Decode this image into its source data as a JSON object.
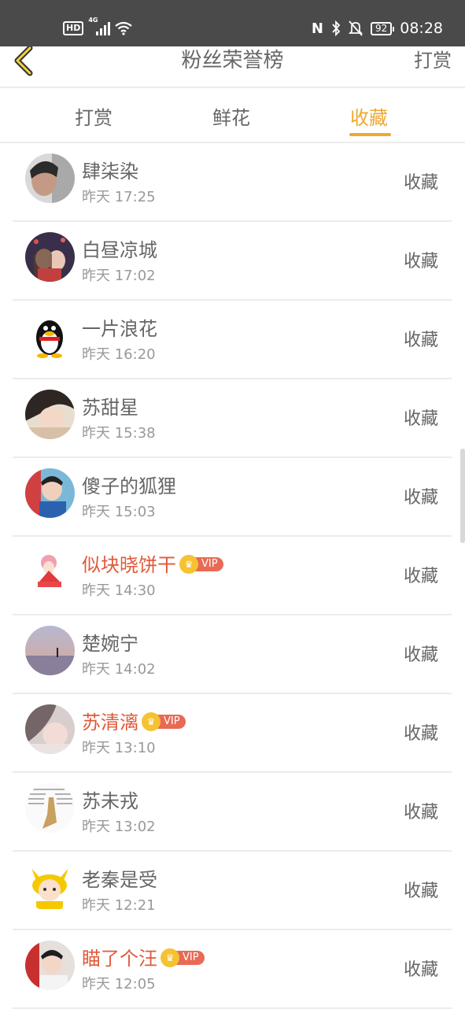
{
  "status_bar": {
    "hd": "HD",
    "network": "4G",
    "battery": "92",
    "time": "08:28"
  },
  "header": {
    "title": "粉丝荣誉榜",
    "action": "打赏"
  },
  "tabs": [
    {
      "label": "打赏",
      "active": false
    },
    {
      "label": "鲜花",
      "active": false
    },
    {
      "label": "收藏",
      "active": true
    }
  ],
  "colors": {
    "accent": "#f0a830",
    "vip_name": "#e05a3a",
    "vip_tag": "#e86a55",
    "crown": "#f5c232"
  },
  "vip_label": "VIP",
  "rows": [
    {
      "name": "肆柒染",
      "time": "昨天 17:25",
      "action": "收藏",
      "vip": false,
      "avatar": "photo-avatar"
    },
    {
      "name": "白昼凉城",
      "time": "昨天 17:02",
      "action": "收藏",
      "vip": false,
      "avatar": "anime-avatar"
    },
    {
      "name": "一片浪花",
      "time": "昨天 16:20",
      "action": "收藏",
      "vip": false,
      "avatar": "penguin-avatar"
    },
    {
      "name": "苏甜星",
      "time": "昨天 15:38",
      "action": "收藏",
      "vip": false,
      "avatar": "photo-avatar"
    },
    {
      "name": "傻子的狐狸",
      "time": "昨天 15:03",
      "action": "收藏",
      "vip": false,
      "avatar": "photo-avatar"
    },
    {
      "name": "似块晓饼干",
      "time": "昨天 14:30",
      "action": "收藏",
      "vip": true,
      "avatar": "anime-avatar"
    },
    {
      "name": "楚婉宁",
      "time": "昨天 14:02",
      "action": "收藏",
      "vip": false,
      "avatar": "sunset-avatar"
    },
    {
      "name": "苏清漓",
      "time": "昨天 13:10",
      "action": "收藏",
      "vip": true,
      "avatar": "photo-avatar"
    },
    {
      "name": "苏未戎",
      "time": "昨天 13:02",
      "action": "收藏",
      "vip": false,
      "avatar": "text-avatar"
    },
    {
      "name": "老秦是受",
      "time": "昨天 12:21",
      "action": "收藏",
      "vip": false,
      "avatar": "pikachu-avatar"
    },
    {
      "name": "瞄了个汪",
      "time": "昨天 12:05",
      "action": "收藏",
      "vip": true,
      "avatar": "photo-avatar"
    }
  ]
}
